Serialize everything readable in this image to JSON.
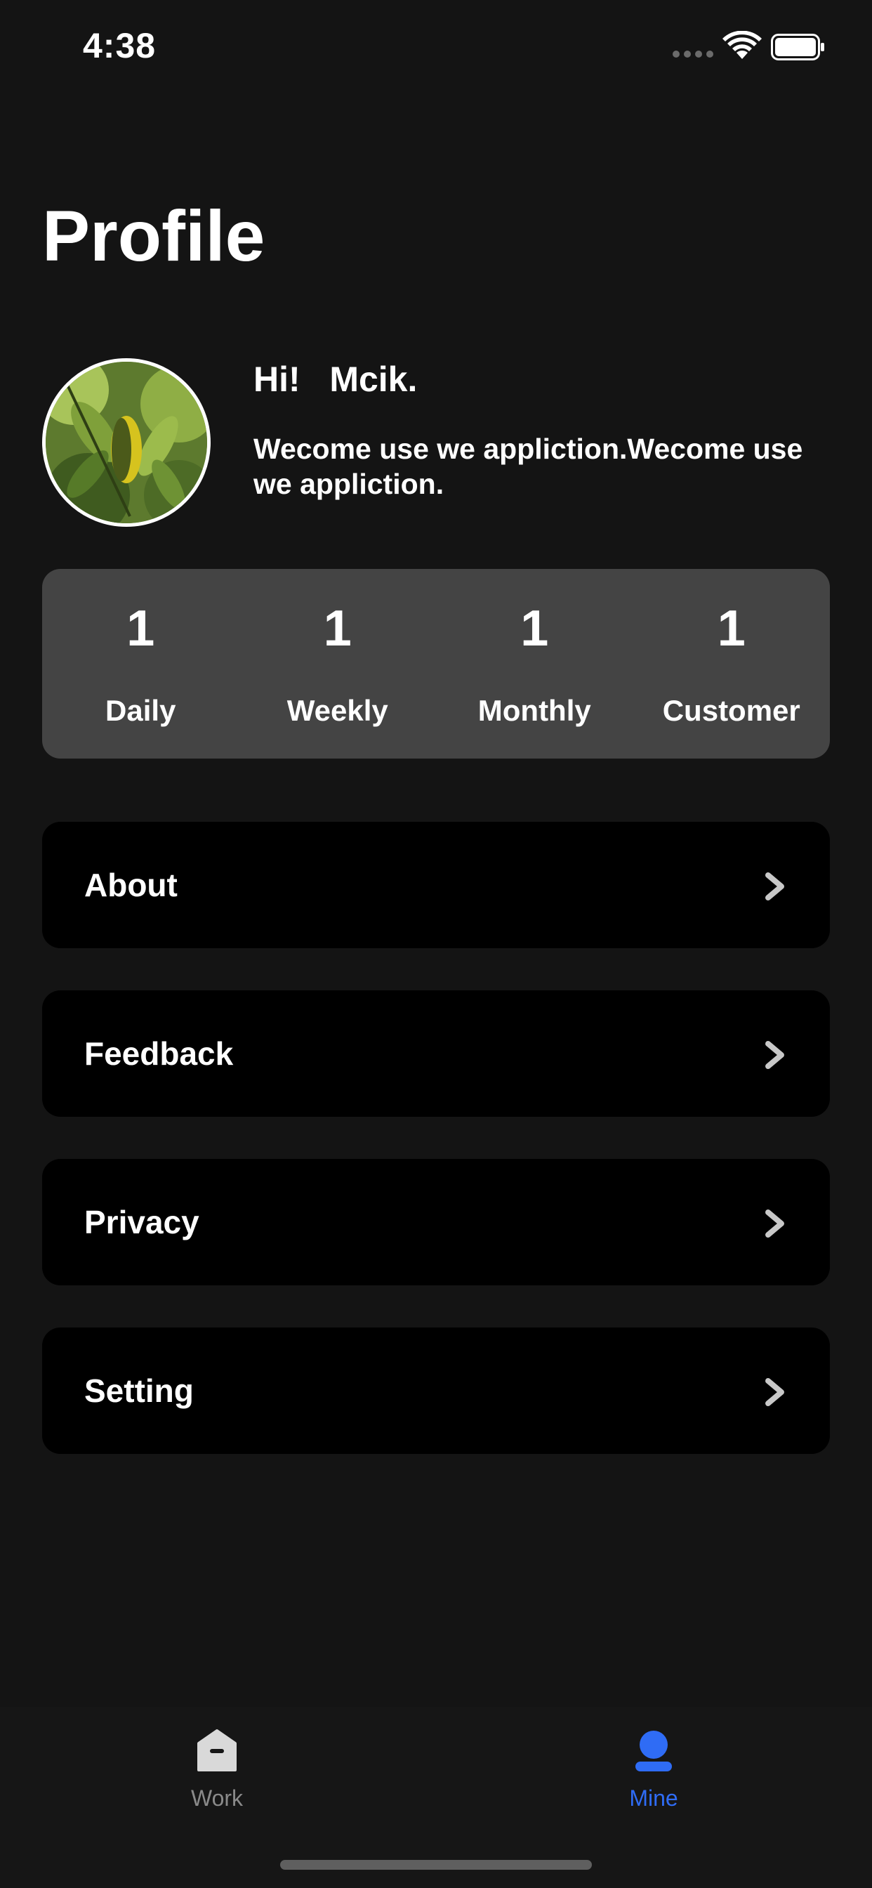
{
  "status_bar": {
    "time": "4:38"
  },
  "page": {
    "title": "Profile"
  },
  "profile": {
    "greeting": "Hi!   Mcik.",
    "welcome": "Wecome use we appliction.Wecome use we appliction."
  },
  "stats": [
    {
      "value": "1",
      "label": "Daily"
    },
    {
      "value": "1",
      "label": "Weekly"
    },
    {
      "value": "1",
      "label": "Monthly"
    },
    {
      "value": "1",
      "label": "Customer"
    }
  ],
  "menu": [
    {
      "label": "About"
    },
    {
      "label": "Feedback"
    },
    {
      "label": "Privacy"
    },
    {
      "label": "Setting"
    }
  ],
  "tabs": [
    {
      "label": "Work",
      "icon": "house-icon",
      "active": false
    },
    {
      "label": "Mine",
      "icon": "person-icon",
      "active": true
    }
  ],
  "colors": {
    "background": "#141414",
    "stats_card": "#444444",
    "menu_row": "#000000",
    "active_tab": "#2f6cf5",
    "inactive_tab": "#8a8a8a"
  }
}
